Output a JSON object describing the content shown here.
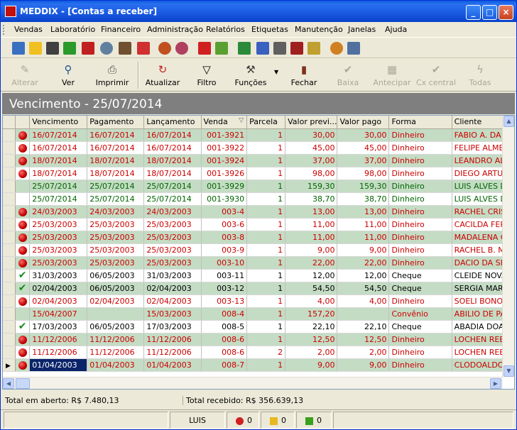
{
  "window": {
    "title": "MEDDIX - [Contas a receber]"
  },
  "menu": [
    "Vendas",
    "Laboratório",
    "Financeiro",
    "Administração",
    "Relatórios",
    "Etiquetas",
    "Manutenção",
    "Janelas",
    "Ajuda"
  ],
  "toolbar": {
    "alterar": "Alterar",
    "ver": "Ver",
    "imprimir": "Imprimir",
    "atualizar": "Atualizar",
    "filtro": "Filtro",
    "funcoes": "Funções",
    "fechar": "Fechar",
    "baixa": "Baixa",
    "antecipar": "Antecipar",
    "cx_central": "Cx central",
    "todas": "Todas"
  },
  "banner": "Vencimento  - 25/07/2014",
  "columns": [
    "Vencimento",
    "Pagamento",
    "Lançamento",
    "Venda",
    "Parcela",
    "Valor previ...",
    "Valor pago",
    "Forma",
    "Cliente"
  ],
  "rows": [
    {
      "status": "red-dot",
      "color": "red",
      "bg": "green",
      "venc": "16/07/2014",
      "pag": "16/07/2014",
      "lanc": "16/07/2014",
      "venda": "001-3921",
      "parc": "1",
      "prev": "30,00",
      "pago": "30,00",
      "forma": "Dinheiro",
      "cliente": "FABIO A. DA"
    },
    {
      "status": "red-dot",
      "color": "red",
      "bg": "white",
      "venc": "16/07/2014",
      "pag": "16/07/2014",
      "lanc": "16/07/2014",
      "venda": "001-3922",
      "parc": "1",
      "prev": "45,00",
      "pago": "45,00",
      "forma": "Dinheiro",
      "cliente": "FELIPE ALMEI"
    },
    {
      "status": "red-dot",
      "color": "red",
      "bg": "green",
      "venc": "18/07/2014",
      "pag": "18/07/2014",
      "lanc": "18/07/2014",
      "venda": "001-3924",
      "parc": "1",
      "prev": "37,00",
      "pago": "37,00",
      "forma": "Dinheiro",
      "cliente": "LEANDRO ALM"
    },
    {
      "status": "red-dot",
      "color": "red",
      "bg": "white",
      "venc": "18/07/2014",
      "pag": "18/07/2014",
      "lanc": "18/07/2014",
      "venda": "001-3926",
      "parc": "1",
      "prev": "98,00",
      "pago": "98,00",
      "forma": "Dinheiro",
      "cliente": "DIEGO ARTUR"
    },
    {
      "status": "",
      "color": "grn",
      "bg": "green",
      "venc": "25/07/2014",
      "pag": "25/07/2014",
      "lanc": "25/07/2014",
      "venda": "001-3929",
      "parc": "1",
      "prev": "159,30",
      "pago": "159,30",
      "forma": "Dinheiro",
      "cliente": "LUIS ALVES D"
    },
    {
      "status": "",
      "color": "grn",
      "bg": "white",
      "venc": "25/07/2014",
      "pag": "25/07/2014",
      "lanc": "25/07/2014",
      "venda": "001-3930",
      "parc": "1",
      "prev": "38,70",
      "pago": "38,70",
      "forma": "Dinheiro",
      "cliente": "LUIS ALVES D"
    },
    {
      "status": "red-dot",
      "color": "red",
      "bg": "green",
      "venc": "24/03/2003",
      "pag": "24/03/2003",
      "lanc": "24/03/2003",
      "venda": "003-4",
      "parc": "1",
      "prev": "13,00",
      "pago": "13,00",
      "forma": "Dinheiro",
      "cliente": "RACHEL CRIS"
    },
    {
      "status": "red-dot",
      "color": "red",
      "bg": "white",
      "venc": "25/03/2003",
      "pag": "25/03/2003",
      "lanc": "25/03/2003",
      "venda": "003-6",
      "parc": "1",
      "prev": "11,00",
      "pago": "11,00",
      "forma": "Dinheiro",
      "cliente": "CACILDA FER"
    },
    {
      "status": "red-dot",
      "color": "red",
      "bg": "green",
      "venc": "25/03/2003",
      "pag": "25/03/2003",
      "lanc": "25/03/2003",
      "venda": "003-8",
      "parc": "1",
      "prev": "11,00",
      "pago": "11,00",
      "forma": "Dinheiro",
      "cliente": "MADALENA C"
    },
    {
      "status": "red-dot",
      "color": "red",
      "bg": "white",
      "venc": "25/03/2003",
      "pag": "25/03/2003",
      "lanc": "25/03/2003",
      "venda": "003-9",
      "parc": "1",
      "prev": "9,00",
      "pago": "9,00",
      "forma": "Dinheiro",
      "cliente": "RACHEL B. M"
    },
    {
      "status": "red-dot",
      "color": "red",
      "bg": "green",
      "venc": "25/03/2003",
      "pag": "25/03/2003",
      "lanc": "25/03/2003",
      "venda": "003-10",
      "parc": "1",
      "prev": "22,00",
      "pago": "22,00",
      "forma": "Dinheiro",
      "cliente": "DACIO DA SIL"
    },
    {
      "status": "check",
      "color": "blk",
      "bg": "white",
      "venc": "31/03/2003",
      "pag": "06/05/2003",
      "lanc": "31/03/2003",
      "venda": "003-11",
      "parc": "1",
      "prev": "12,00",
      "pago": "12,00",
      "forma": "Cheque",
      "cliente": "CLEIDE NOVA"
    },
    {
      "status": "check",
      "color": "blk",
      "bg": "green",
      "venc": "02/04/2003",
      "pag": "06/05/2003",
      "lanc": "02/04/2003",
      "venda": "003-12",
      "parc": "1",
      "prev": "54,50",
      "pago": "54,50",
      "forma": "Cheque",
      "cliente": "SERGIA MARI"
    },
    {
      "status": "red-dot",
      "color": "red",
      "bg": "white",
      "venc": "02/04/2003",
      "pag": "02/04/2003",
      "lanc": "02/04/2003",
      "venda": "003-13",
      "parc": "1",
      "prev": "4,00",
      "pago": "4,00",
      "forma": "Dinheiro",
      "cliente": "SOELI BONOR"
    },
    {
      "status": "",
      "color": "red",
      "bg": "green",
      "venc": "15/04/2007",
      "pag": "",
      "lanc": "15/03/2003",
      "venda": "008-4",
      "parc": "1",
      "prev": "157,20",
      "pago": "",
      "forma": "Convênio",
      "cliente": "ABILIO DE PA"
    },
    {
      "status": "check",
      "color": "blk",
      "bg": "white",
      "venc": "17/03/2003",
      "pag": "06/05/2003",
      "lanc": "17/03/2003",
      "venda": "008-5",
      "parc": "1",
      "prev": "22,10",
      "pago": "22,10",
      "forma": "Cheque",
      "cliente": "ABADIA DOAR"
    },
    {
      "status": "red-dot",
      "color": "red",
      "bg": "green",
      "venc": "11/12/2006",
      "pag": "11/12/2006",
      "lanc": "11/12/2006",
      "venda": "008-6",
      "parc": "1",
      "prev": "12,50",
      "pago": "12,50",
      "forma": "Dinheiro",
      "cliente": "LOCHEN REEI"
    },
    {
      "status": "red-dot",
      "color": "red",
      "bg": "white",
      "venc": "11/12/2006",
      "pag": "11/12/2006",
      "lanc": "11/12/2006",
      "venda": "008-6",
      "parc": "2",
      "prev": "2,00",
      "pago": "2,00",
      "forma": "Dinheiro",
      "cliente": "LOCHEN REEI"
    },
    {
      "status": "red-dot",
      "color": "red",
      "bg": "green",
      "venc": "01/04/2003",
      "pag": "01/04/2003",
      "lanc": "01/04/2003",
      "venda": "008-7",
      "parc": "1",
      "prev": "9,00",
      "pago": "9,00",
      "forma": "Dinheiro",
      "cliente": "CLODOALDO",
      "current": true
    }
  ],
  "totals": {
    "aberto": "Total em aberto: R$ 7.480,13",
    "recebido": "Total recebido: R$ 356.639,13"
  },
  "status": {
    "user": "LUIS",
    "alerts": "0",
    "yellow_flags": "0",
    "green_flags": "0"
  }
}
